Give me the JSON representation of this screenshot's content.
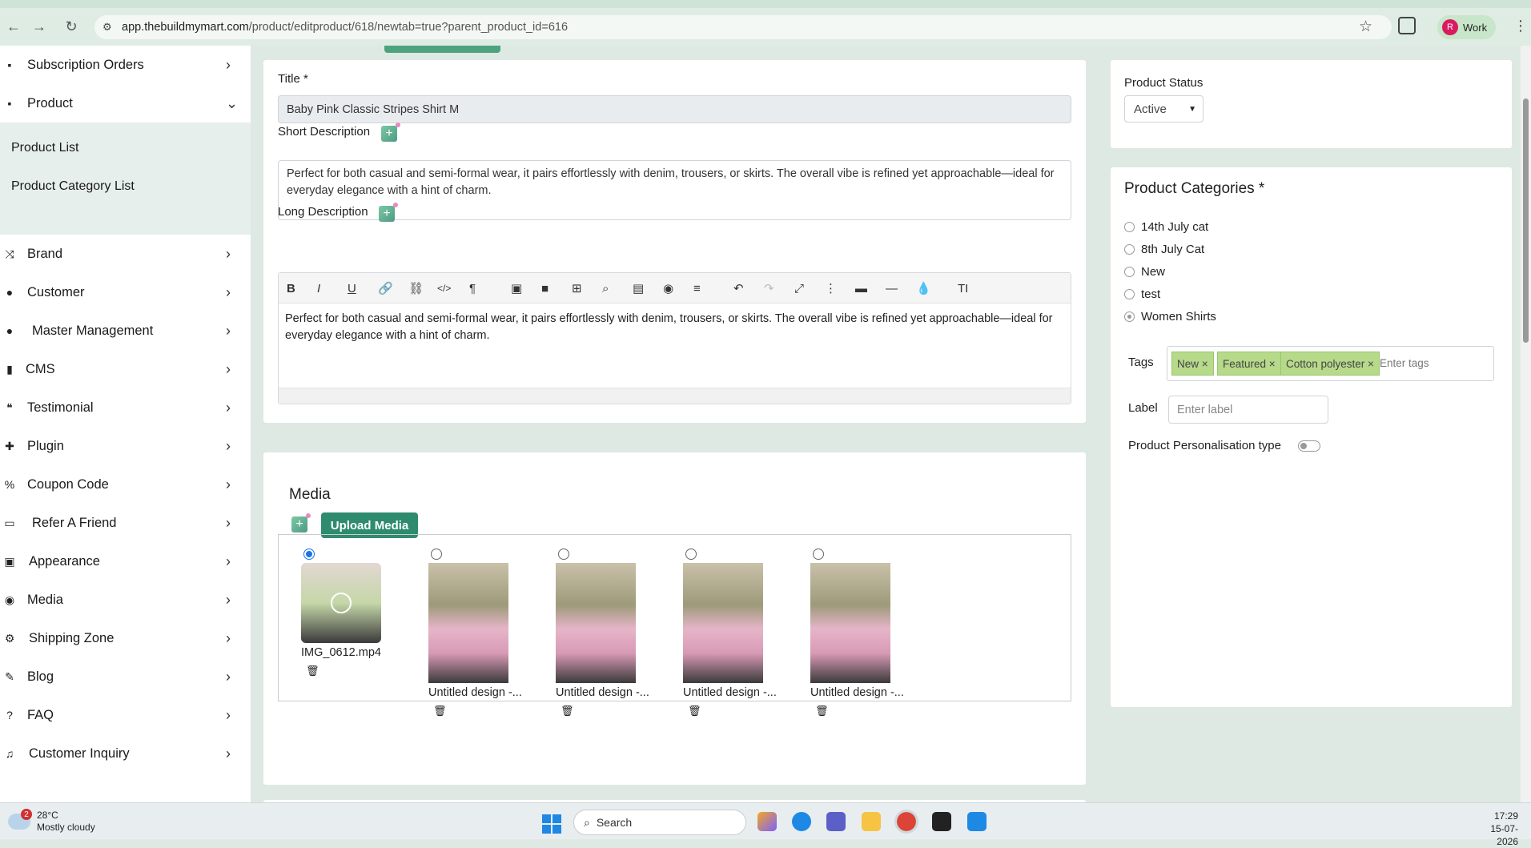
{
  "browser": {
    "url_host": "app.thebuildmymart.com",
    "url_path": "/product/editproduct/618/newtab=true?parent_product_id=616",
    "profile_initial": "R",
    "profile_label": "Work"
  },
  "sidebar": {
    "items": [
      {
        "label": "Subscription Orders",
        "icon": "bag-icon",
        "chevron": "›"
      },
      {
        "label": "Product",
        "icon": "archive-icon",
        "chevron": "⌄"
      },
      {
        "label": "Brand",
        "icon": "shuffle-icon",
        "chevron": "›"
      },
      {
        "label": "Customer",
        "icon": "user-icon",
        "chevron": "›"
      },
      {
        "label": "Master Management",
        "icon": "users-gear-icon",
        "chevron": "›"
      },
      {
        "label": "CMS",
        "icon": "file-icon",
        "chevron": "›"
      },
      {
        "label": "Testimonial",
        "icon": "quote-icon",
        "chevron": "›"
      },
      {
        "label": "Plugin",
        "icon": "puzzle-icon",
        "chevron": "›"
      },
      {
        "label": "Coupon Code",
        "icon": "percent-icon",
        "chevron": "›"
      },
      {
        "label": "Refer A Friend",
        "icon": "keyboard-icon",
        "chevron": "›"
      },
      {
        "label": "Appearance",
        "icon": "image-icon",
        "chevron": "›"
      },
      {
        "label": "Media",
        "icon": "play-circle-icon",
        "chevron": "›"
      },
      {
        "label": "Shipping Zone",
        "icon": "gear-icon",
        "chevron": "›"
      },
      {
        "label": "Blog",
        "icon": "pencil-icon",
        "chevron": "›"
      },
      {
        "label": "FAQ",
        "icon": "question-icon",
        "chevron": "›"
      },
      {
        "label": "Customer Inquiry",
        "icon": "headphones-icon",
        "chevron": "›"
      }
    ],
    "product_sub": [
      "Product List",
      "Product Category List"
    ]
  },
  "form": {
    "title_label": "Title *",
    "title_value": "Baby Pink Classic Stripes Shirt M",
    "short_desc_label": "Short Description",
    "short_desc_value": "Perfect for both casual and semi-formal wear, it pairs effortlessly with denim, trousers, or skirts. The overall vibe is refined yet approachable—ideal for everyday elegance with a hint of charm.",
    "long_desc_label": "Long Description",
    "long_desc_value": "Perfect for both casual and semi-formal wear, it pairs effortlessly with denim, trousers, or skirts. The overall vibe is refined yet approachable—ideal for everyday elegance with a hint of charm."
  },
  "toolbar": [
    "B",
    "I",
    "U",
    "🔗",
    "⛓",
    "</>",
    "¶",
    "▣",
    "■",
    "⊞",
    "⌕",
    "▤",
    "◉",
    "≡",
    "↶",
    "↷",
    "⤢",
    "⋮",
    "▬",
    "—",
    "💧",
    "TI"
  ],
  "status": {
    "label": "Product Status",
    "value": "Active"
  },
  "categories": {
    "title": "Product Categories *",
    "items": [
      {
        "label": "14th July cat",
        "checked": false
      },
      {
        "label": "8th July Cat",
        "checked": false
      },
      {
        "label": "New",
        "checked": false
      },
      {
        "label": "test",
        "checked": false
      },
      {
        "label": "Women Shirts",
        "checked": true
      }
    ]
  },
  "tags": {
    "label": "Tags",
    "items": [
      "New ×",
      "Featured ×",
      "Cotton polyester ×"
    ],
    "placeholder": "Enter tags"
  },
  "label_field": {
    "label": "Label",
    "placeholder": "Enter label"
  },
  "personalisation": {
    "label": "Product Personalisation type"
  },
  "media": {
    "title": "Media",
    "upload_label": "Upload Media",
    "items": [
      {
        "name": "IMG_0612.mp4",
        "selected": true
      },
      {
        "name": "Untitled design -...",
        "selected": false
      },
      {
        "name": "Untitled design -...",
        "selected": false
      },
      {
        "name": "Untitled design -...",
        "selected": false
      },
      {
        "name": "Untitled design -...",
        "selected": false
      }
    ]
  },
  "taskbar": {
    "weather_badge": "2",
    "weather_temp": "28°C",
    "weather_desc": "Mostly cloudy",
    "search_label": "Search",
    "time": "17:29",
    "date": "15-07-2026"
  },
  "colors": {
    "accent": "#2e8b6e",
    "tag_bg": "#b6d98a",
    "chat": "#1aa772"
  }
}
